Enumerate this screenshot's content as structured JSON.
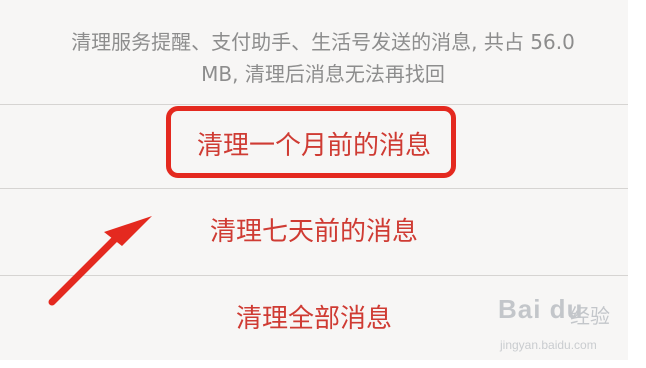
{
  "notice": {
    "line1": "清理服务提醒、支付助手、生活号发送的消息, 共占 56.0",
    "line2": "MB, 清理后消息无法再找回"
  },
  "actions": [
    {
      "label": "清理一个月前的消息",
      "highlighted": true
    },
    {
      "label": "清理七天前的消息",
      "highlighted": false
    },
    {
      "label": "清理全部消息",
      "highlighted": false
    }
  ],
  "colors": {
    "action_text": "#cf3b33",
    "highlight_border": "#e4291f",
    "arrow": "#e4291f",
    "notice_text": "#8d8d8d",
    "background": "#f7f6f5"
  },
  "watermark": {
    "brand": "Bai du",
    "cn": "经验",
    "url": "jingyan.baidu.com"
  }
}
